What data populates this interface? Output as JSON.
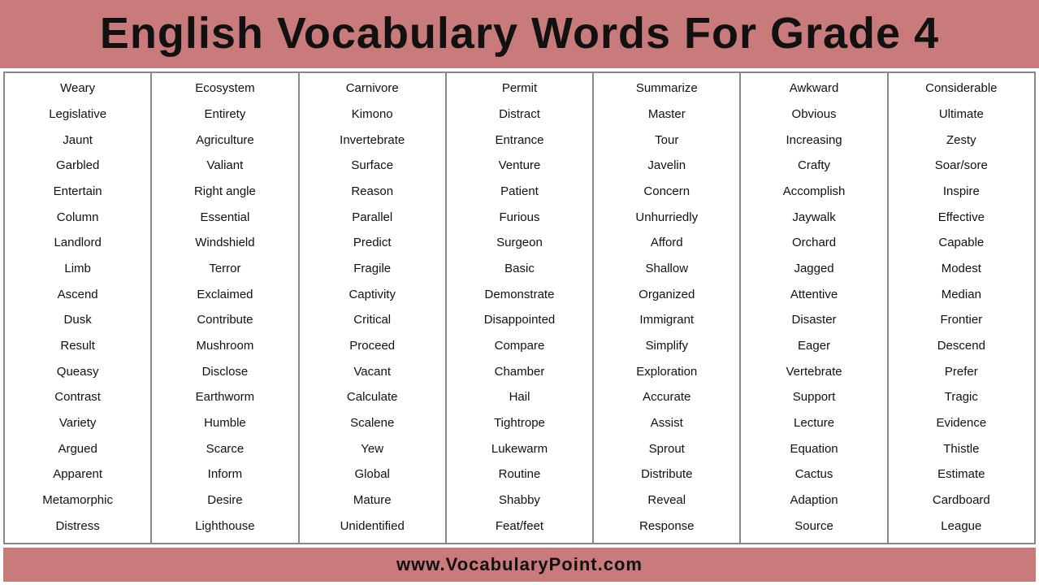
{
  "header": {
    "title": "English Vocabulary Words For Grade 4"
  },
  "footer": {
    "url": "www.VocabularyPoint.com"
  },
  "columns": [
    {
      "id": "col1",
      "words": [
        "Weary",
        "Legislative",
        "Jaunt",
        "Garbled",
        "Entertain",
        "Column",
        "Landlord",
        "Limb",
        "Ascend",
        "Dusk",
        "Result",
        "Queasy",
        "Contrast",
        "Variety",
        "Argued",
        "Apparent",
        "Metamorphic",
        "Distress"
      ]
    },
    {
      "id": "col2",
      "words": [
        "Ecosystem",
        "Entirety",
        "Agriculture",
        "Valiant",
        "Right angle",
        "Essential",
        "Windshield",
        "Terror",
        "Exclaimed",
        "Contribute",
        "Mushroom",
        "Disclose",
        "Earthworm",
        "Humble",
        "Scarce",
        "Inform",
        "Desire",
        "Lighthouse"
      ]
    },
    {
      "id": "col3",
      "words": [
        "Carnivore",
        "Kimono",
        "Invertebrate",
        "Surface",
        "Reason",
        "Parallel",
        "Predict",
        "Fragile",
        "Captivity",
        "Critical",
        "Proceed",
        "Vacant",
        "Calculate",
        "Scalene",
        "Yew",
        "Global",
        "Mature",
        "Unidentified"
      ]
    },
    {
      "id": "col4",
      "words": [
        "Permit",
        "Distract",
        "Entrance",
        "Venture",
        "Patient",
        "Furious",
        "Surgeon",
        "Basic",
        "Demonstrate",
        "Disappointed",
        "Compare",
        "Chamber",
        "Hail",
        "Tightrope",
        "Lukewarm",
        "Routine",
        "Shabby",
        "Feat/feet"
      ]
    },
    {
      "id": "col5",
      "words": [
        "Summarize",
        "Master",
        "Tour",
        "Javelin",
        "Concern",
        "Unhurriedly",
        "Afford",
        "Shallow",
        "Organized",
        "Immigrant",
        "Simplify",
        "Exploration",
        "Accurate",
        "Assist",
        "Sprout",
        "Distribute",
        "Reveal",
        "Response"
      ]
    },
    {
      "id": "col6",
      "words": [
        "Awkward",
        "Obvious",
        "Increasing",
        "Crafty",
        "Accomplish",
        "Jaywalk",
        "Orchard",
        "Jagged",
        "Attentive",
        "Disaster",
        "Eager",
        "Vertebrate",
        "Support",
        "Lecture",
        "Equation",
        "Cactus",
        "Adaption",
        "Source"
      ]
    },
    {
      "id": "col7",
      "words": [
        "Considerable",
        "Ultimate",
        "Zesty",
        "Soar/sore",
        "Inspire",
        "Effective",
        "Capable",
        "Modest",
        "Median",
        "Frontier",
        "Descend",
        "Prefer",
        "Tragic",
        "Evidence",
        "Thistle",
        "Estimate",
        "Cardboard",
        "League"
      ]
    }
  ]
}
